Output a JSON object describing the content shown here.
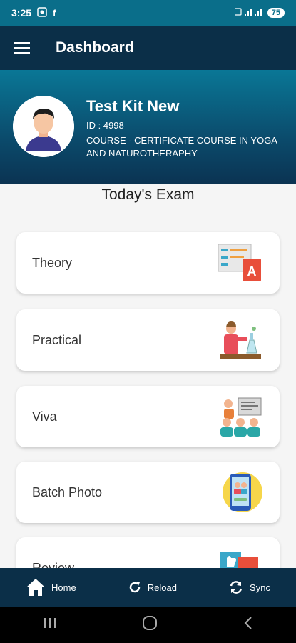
{
  "status_bar": {
    "time": "3:25",
    "battery": "75"
  },
  "app_bar": {
    "title": "Dashboard"
  },
  "profile": {
    "name": "Test Kit New",
    "id_text": "ID : 4998",
    "course_text": "COURSE - CERTIFICATE COURSE IN YOGA AND NATUROTHERAPHY"
  },
  "section": {
    "title": "Today's Exam"
  },
  "cards": [
    {
      "label": "Theory",
      "icon": "theory-icon"
    },
    {
      "label": "Practical",
      "icon": "practical-icon"
    },
    {
      "label": "Viva",
      "icon": "viva-icon"
    },
    {
      "label": "Batch Photo",
      "icon": "batch-photo-icon"
    },
    {
      "label": "Review",
      "icon": "review-icon"
    }
  ],
  "bottom_nav": {
    "home": "Home",
    "reload": "Reload",
    "sync": "Sync"
  },
  "colors": {
    "app_bar": "#0b2f48",
    "profile_gradient_top": "#0a7796",
    "status_bar": "#0a6e8a"
  }
}
